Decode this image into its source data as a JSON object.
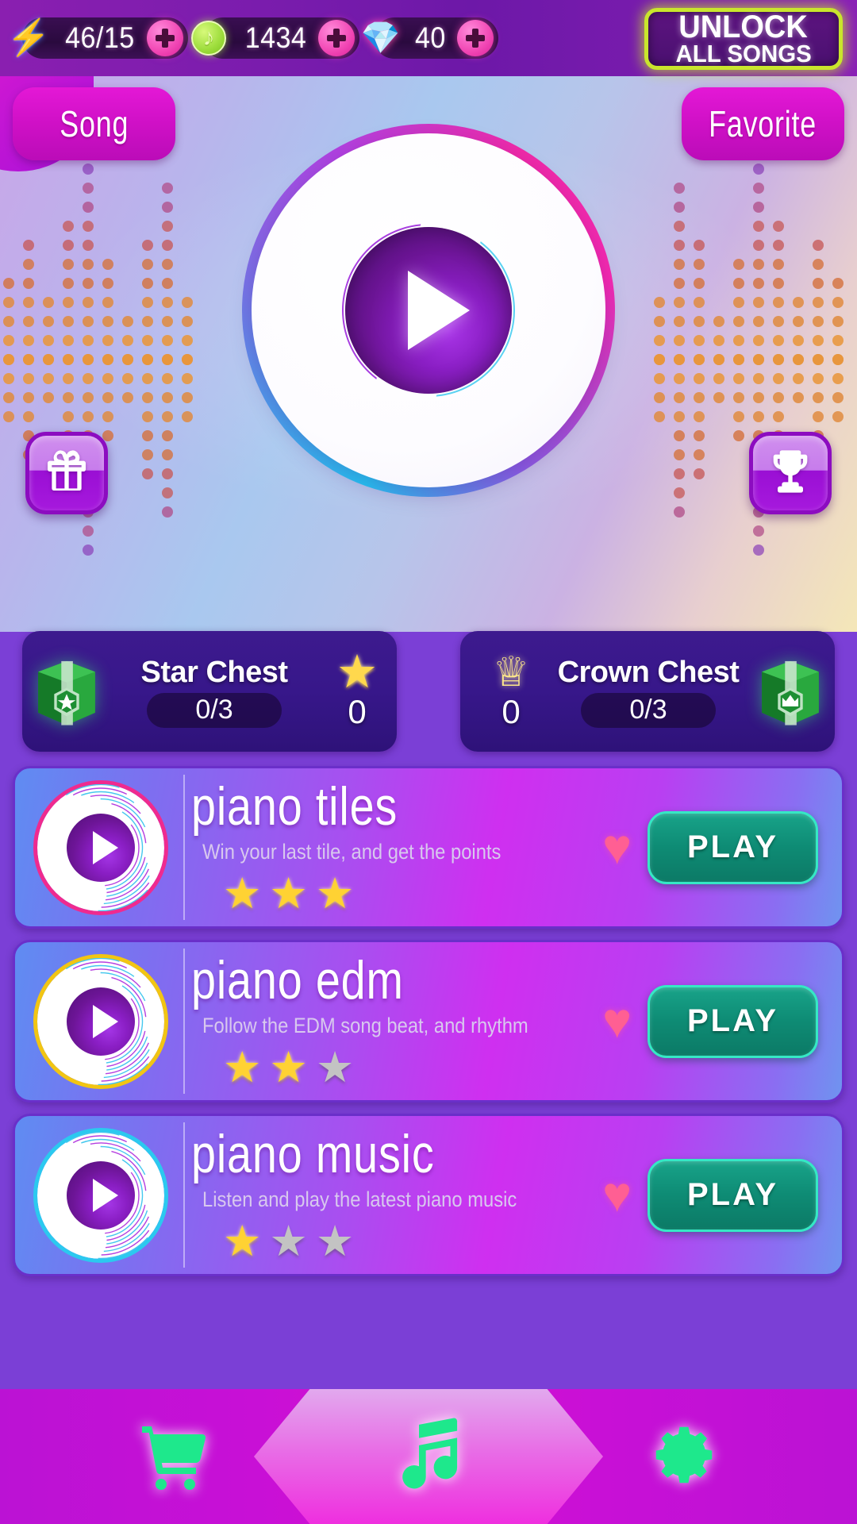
{
  "hud": {
    "energy": {
      "icon": "lightning-bolt-icon",
      "value": "46/15",
      "add_label": "+"
    },
    "coins": {
      "icon": "music-note-coin-icon",
      "value": "1434",
      "add_label": "+"
    },
    "gems": {
      "icon": "diamond-icon",
      "value": "40",
      "add_label": "+"
    },
    "unlock_button": {
      "line1": "UNLOCK",
      "line2": "ALL SONGS",
      "border_color": "#c9e62c"
    }
  },
  "hero": {
    "tab_song": "Song",
    "tab_favorite": "Favorite",
    "disc_icon": "play-icon",
    "gift_icon": "gift-icon",
    "trophy_icon": "trophy-icon"
  },
  "chests": [
    {
      "name": "Star Chest",
      "progress": "0/3",
      "amount": "0",
      "badge_icon": "star-icon",
      "box_icon": "star-chest-box-icon",
      "icon_side": "right"
    },
    {
      "name": "Crown Chest",
      "progress": "0/3",
      "amount": "0",
      "badge_icon": "crown-icon",
      "box_icon": "crown-chest-box-icon",
      "icon_side": "left"
    }
  ],
  "songs": [
    {
      "title": "piano tiles",
      "subtitle": "Win your last tile, and get the points",
      "stars_filled": 3,
      "stars_total": 3,
      "favorited": true,
      "play_label": "PLAY",
      "ring_color": "#ef2a8f"
    },
    {
      "title": "piano edm",
      "subtitle": "Follow the EDM song beat, and rhythm",
      "stars_filled": 2,
      "stars_total": 3,
      "favorited": true,
      "play_label": "PLAY",
      "ring_color": "#f2c513"
    },
    {
      "title": "piano music",
      "subtitle": "Listen and play the latest piano music",
      "stars_filled": 1,
      "stars_total": 3,
      "favorited": true,
      "play_label": "PLAY",
      "ring_color": "#2bc9ef"
    }
  ],
  "bottom_nav": [
    {
      "icon": "shopping-cart-icon",
      "active": false
    },
    {
      "icon": "music-note-icon",
      "active": true
    },
    {
      "icon": "gear-icon",
      "active": false
    }
  ],
  "colors": {
    "accent_pink": "#e418d6",
    "accent_green": "#1ee88c",
    "gold": "#ffd233",
    "grey_star": "#c3c3c3",
    "chest_bg": "#3d1a8e"
  }
}
